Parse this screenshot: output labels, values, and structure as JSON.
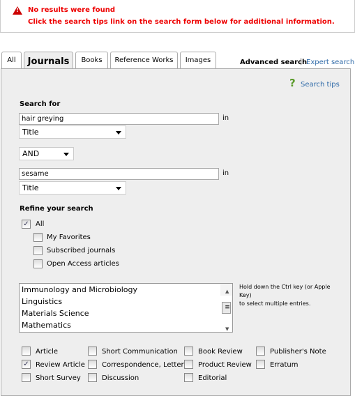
{
  "alert": {
    "icon": "warning-icon",
    "title": "No results were found",
    "message": "Click the search tips link on the search form below for additional information."
  },
  "tabs": [
    {
      "label": "All"
    },
    {
      "label": "Journals",
      "active": true
    },
    {
      "label": "Books"
    },
    {
      "label": "Reference Works"
    },
    {
      "label": "Images"
    }
  ],
  "modes": {
    "advanced": "Advanced search",
    "separator": "|",
    "expert": "Expert search"
  },
  "search_tips": "Search tips",
  "form": {
    "search_for": "Search for",
    "term1": "hair greying",
    "in1": "in",
    "field1": "Title",
    "operator": "AND",
    "term2": "sesame",
    "in2": "in",
    "field2": "Title",
    "refine": "Refine your search",
    "scope": [
      {
        "label": "All",
        "checked": true
      },
      {
        "label": "My Favorites",
        "checked": false
      },
      {
        "label": "Subscribed journals",
        "checked": false
      },
      {
        "label": "Open Access articles",
        "checked": false
      }
    ],
    "subjects": [
      "Immunology and Microbiology",
      "Linguistics",
      "Materials Science",
      "Mathematics"
    ],
    "hint": "Hold down the Ctrl key (or Apple Key)",
    "hint2": "to select multiple entries.",
    "doc_types": [
      {
        "label": "Article",
        "checked": false
      },
      {
        "label": "Short Communication",
        "checked": false
      },
      {
        "label": "Book Review",
        "checked": false
      },
      {
        "label": "Publisher's Note",
        "checked": false
      },
      {
        "label": "Review Article",
        "checked": true
      },
      {
        "label": "Correspondence, Letter",
        "checked": false
      },
      {
        "label": "Product Review",
        "checked": false
      },
      {
        "label": "Erratum",
        "checked": false
      },
      {
        "label": "Short Survey",
        "checked": false
      },
      {
        "label": "Discussion",
        "checked": false
      },
      {
        "label": "Editorial",
        "checked": false
      }
    ]
  }
}
